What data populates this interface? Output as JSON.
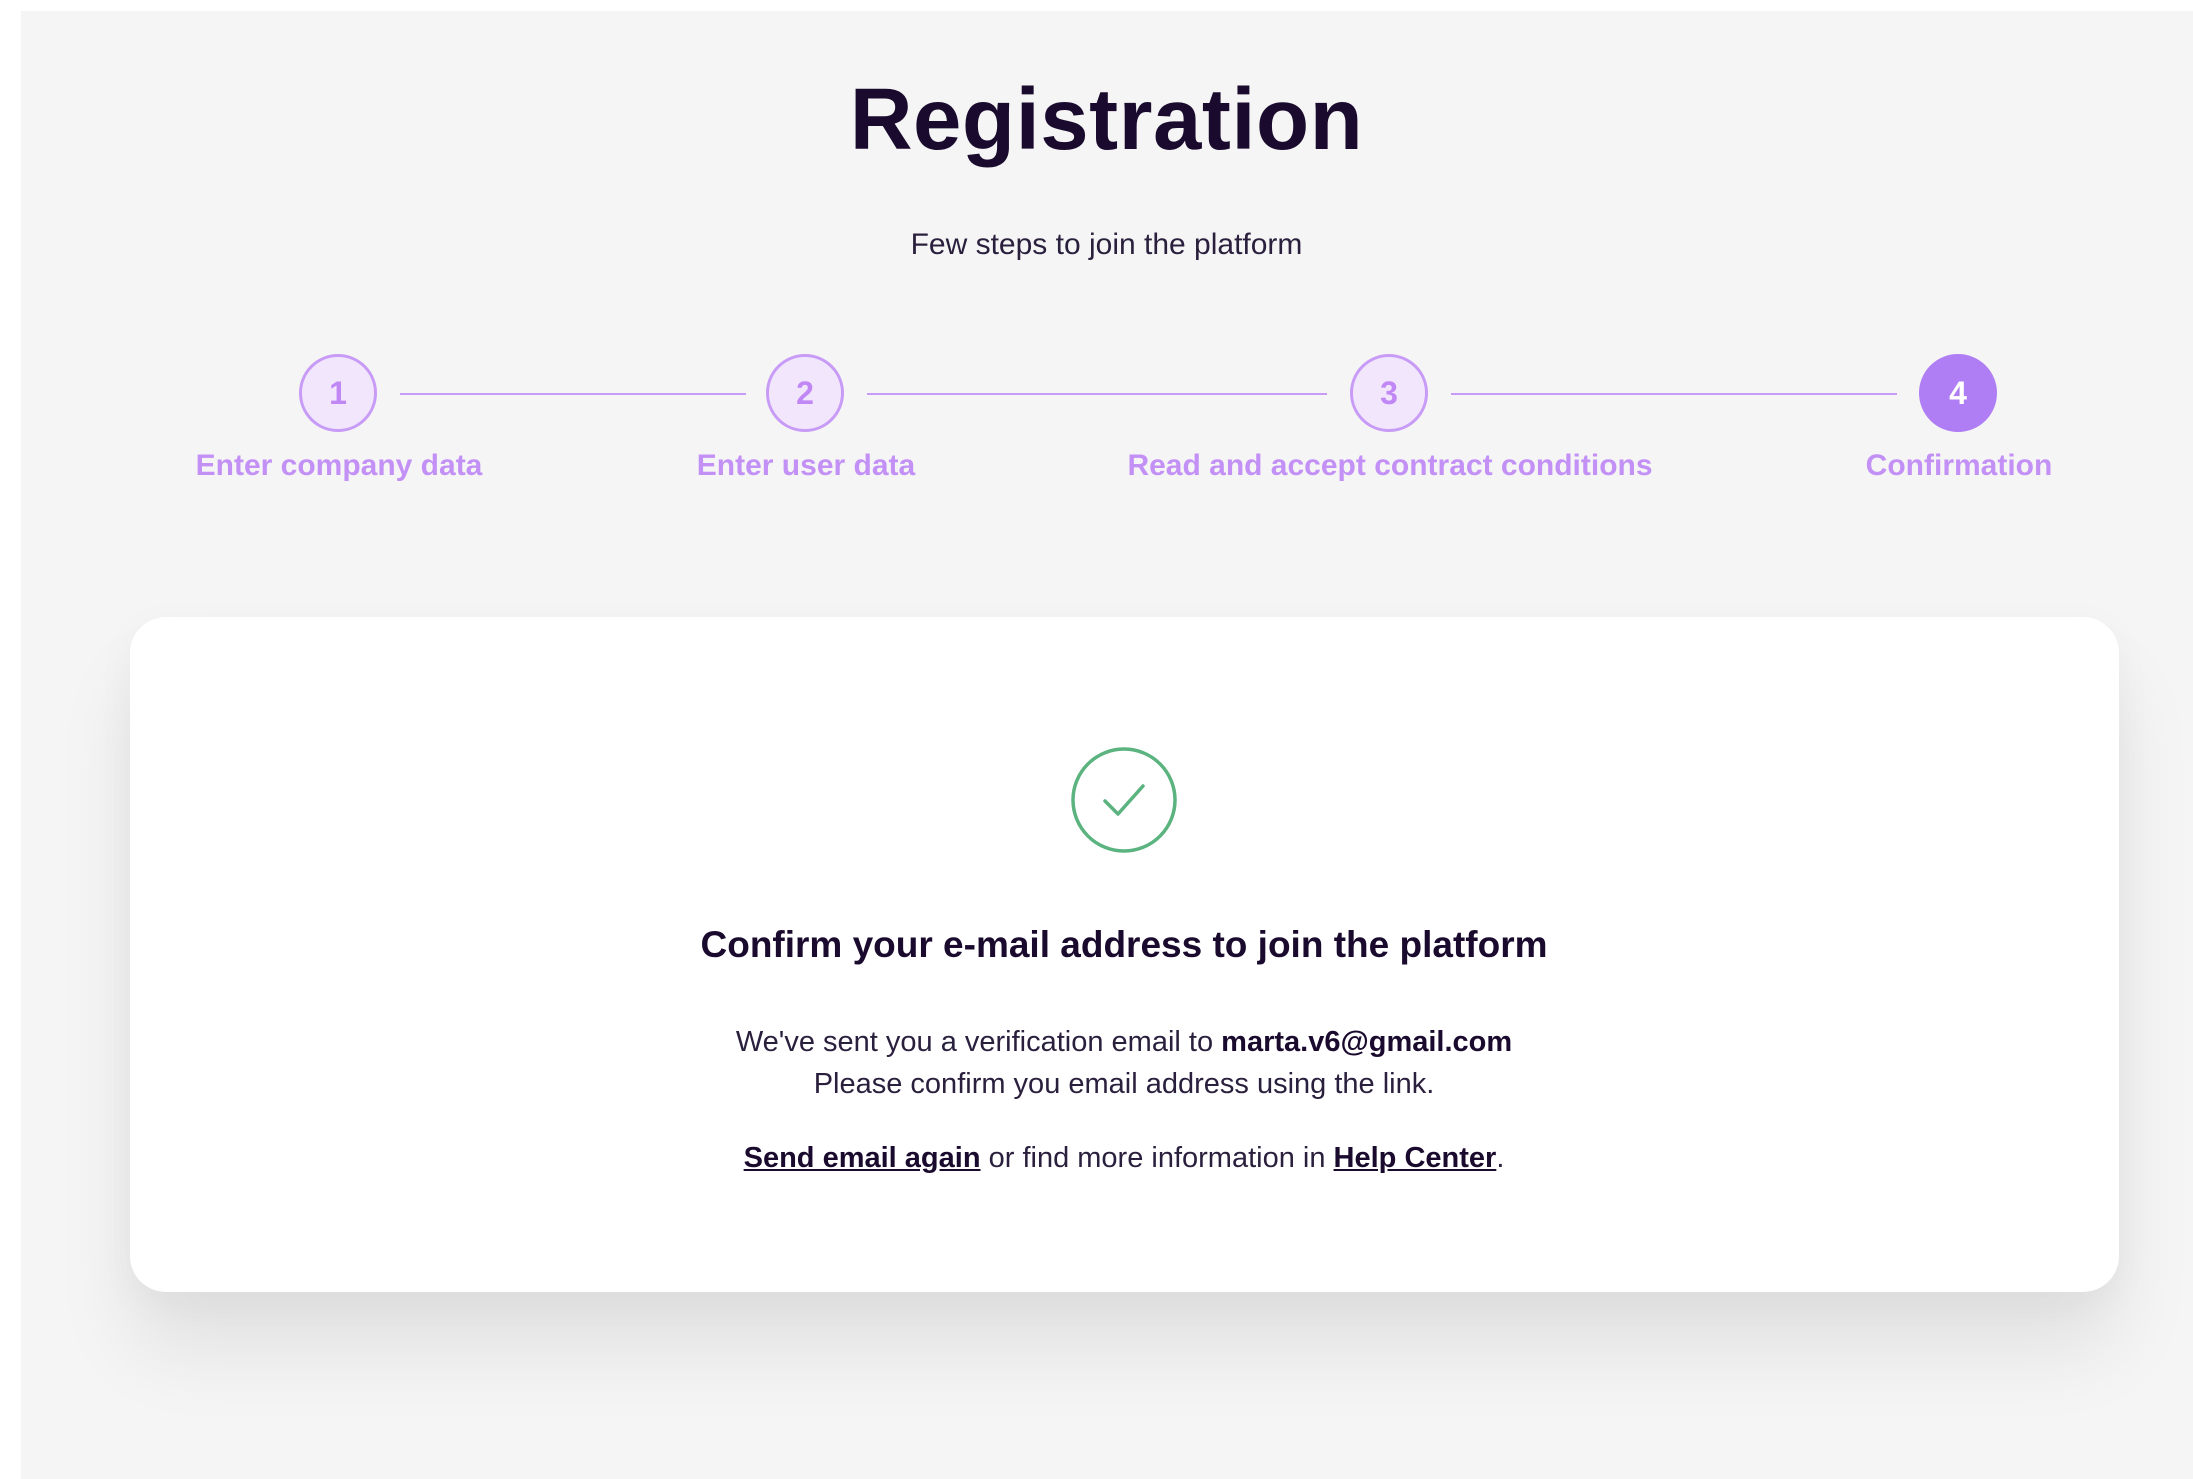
{
  "header": {
    "title": "Registration",
    "subtitle": "Few steps to join the platform"
  },
  "steps": [
    {
      "number": "1",
      "label": "Enter company data"
    },
    {
      "number": "2",
      "label": "Enter user data"
    },
    {
      "number": "3",
      "label": "Read and accept contract conditions"
    },
    {
      "number": "4",
      "label": "Confirmation",
      "active": true
    }
  ],
  "card": {
    "icon": "check-circle-icon",
    "title": "Confirm your e-mail address to join the platform",
    "sent_prefix": "We've sent you a verification email to",
    "email": "marta.v6@gmail.com",
    "confirm_text": "Please confirm you email address using the link.",
    "send_again": "Send email again",
    "middle_text": "or find more information in",
    "help_center": "Help Center",
    "end_punct": "."
  },
  "colors": {
    "accent": "#b07ef4",
    "success": "#5bb37f",
    "text": "#1a0b2e"
  }
}
